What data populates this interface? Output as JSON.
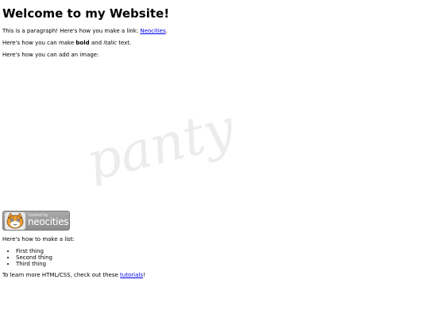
{
  "heading": "Welcome to my Website!",
  "paragraph1": {
    "before": "This is a paragraph! Here's how you make a link: ",
    "link": "Neocities",
    "after": "."
  },
  "paragraph2": {
    "before": "Here's how you can make ",
    "bold": "bold",
    "middle": " and ",
    "italic": "italic",
    "after": " text."
  },
  "paragraph3": "Here's how you can add an image:",
  "image": {
    "watermark_text": "panty",
    "watermark_color": "#ececec"
  },
  "badge": {
    "small_text": "hosted by",
    "big_text": "neocities",
    "icon": "neocities-cat-icon"
  },
  "paragraph4": "Here's how to make a list:",
  "list": [
    "First thing",
    "Second thing",
    "Third thing"
  ],
  "paragraph5": {
    "before": "To learn more HTML/CSS, check out these ",
    "link": "tutorials",
    "after": "!"
  },
  "colors": {
    "link": "#0000ee",
    "text": "#000000",
    "background": "#ffffff",
    "badge_gray": "#9a9a9a",
    "cat_orange": "#f0a030"
  }
}
